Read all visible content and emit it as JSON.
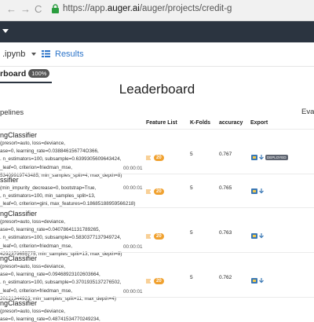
{
  "browser": {
    "url_prefix": "https://app.",
    "url_domain": "auger.ai",
    "url_path": "/auger/projects/credit-g",
    "back_glyph": "←",
    "forward_glyph": "→",
    "reload_glyph": "C"
  },
  "tabs": {
    "file_label": ".ipynb",
    "results_label": "Results"
  },
  "leaderboard_tab": {
    "label": "rboard",
    "percent": "100%"
  },
  "title": "Leaderboard",
  "left_header": "pelines",
  "right_header": "Evalu",
  "columns": {
    "feature_list": "Feature List",
    "kfolds": "K-Folds",
    "accuracy": "accuracy",
    "export": "Export"
  },
  "rows": [
    {
      "model": "ngClassifier",
      "params": [
        "(presort=auto, loss=deviance,",
        "ase=0, learning_rate=0.038846156774O366,",
        ". n_estimators=100, subsample=0.6399305609643424,",
        "_leaf=0, criterion=friedman_mse,",
        "53409919743485, min_samples_split=4, max_depth=8)"
      ],
      "duration": "00:00:01",
      "features": "20",
      "kfolds": "5",
      "accuracy": "0.767",
      "deployed_label": "DEPLOYED"
    },
    {
      "model": "ssifier",
      "params": [
        "(min_impurity_decrease=0, bootstrap=True,",
        ", n_estimators=100, min_samples_split=13,",
        "_leaf=0, criterion=gini, max_features=0.18685188959566218)"
      ],
      "duration": "00:00:01",
      "features": "20",
      "kfolds": "5",
      "accuracy": "0.765",
      "deployed_label": ""
    },
    {
      "model": "ngClassifier",
      "params": [
        "(presort=auto, loss=deviance,",
        "ase=0, learning_rate=0.04078641131789265,",
        ". n_estimators=100, subsample=0.5830377137949724,",
        "_leaf=0, criterion=friedman_mse,",
        "4292379655775, min_samples_split=13, max_depth=8)"
      ],
      "duration": "00:00:01",
      "features": "20",
      "kfolds": "5",
      "accuracy": "0.763",
      "deployed_label": ""
    },
    {
      "model": "ngClassifier",
      "params": [
        "(presort=auto, loss=deviance,",
        "ase=0, learning_rate=0.09468923102603664,",
        ". n_estimators=100, subsample=0.3701935137276502,",
        "_leaf=0, criterion=friedman_mse,",
        "20121344923, min_samples_split=11, max_depth=4)"
      ],
      "duration": "00:00:01",
      "features": "20",
      "kfolds": "5",
      "accuracy": "0.762",
      "deployed_label": ""
    },
    {
      "model": "ngClassifier",
      "params": [
        "(presort=auto, loss=deviance,",
        "ase=0, learning_rate=0.48741534770249234,"
      ],
      "duration": "",
      "features": "",
      "kfolds": "",
      "accuracy": "",
      "deployed_label": ""
    }
  ]
}
